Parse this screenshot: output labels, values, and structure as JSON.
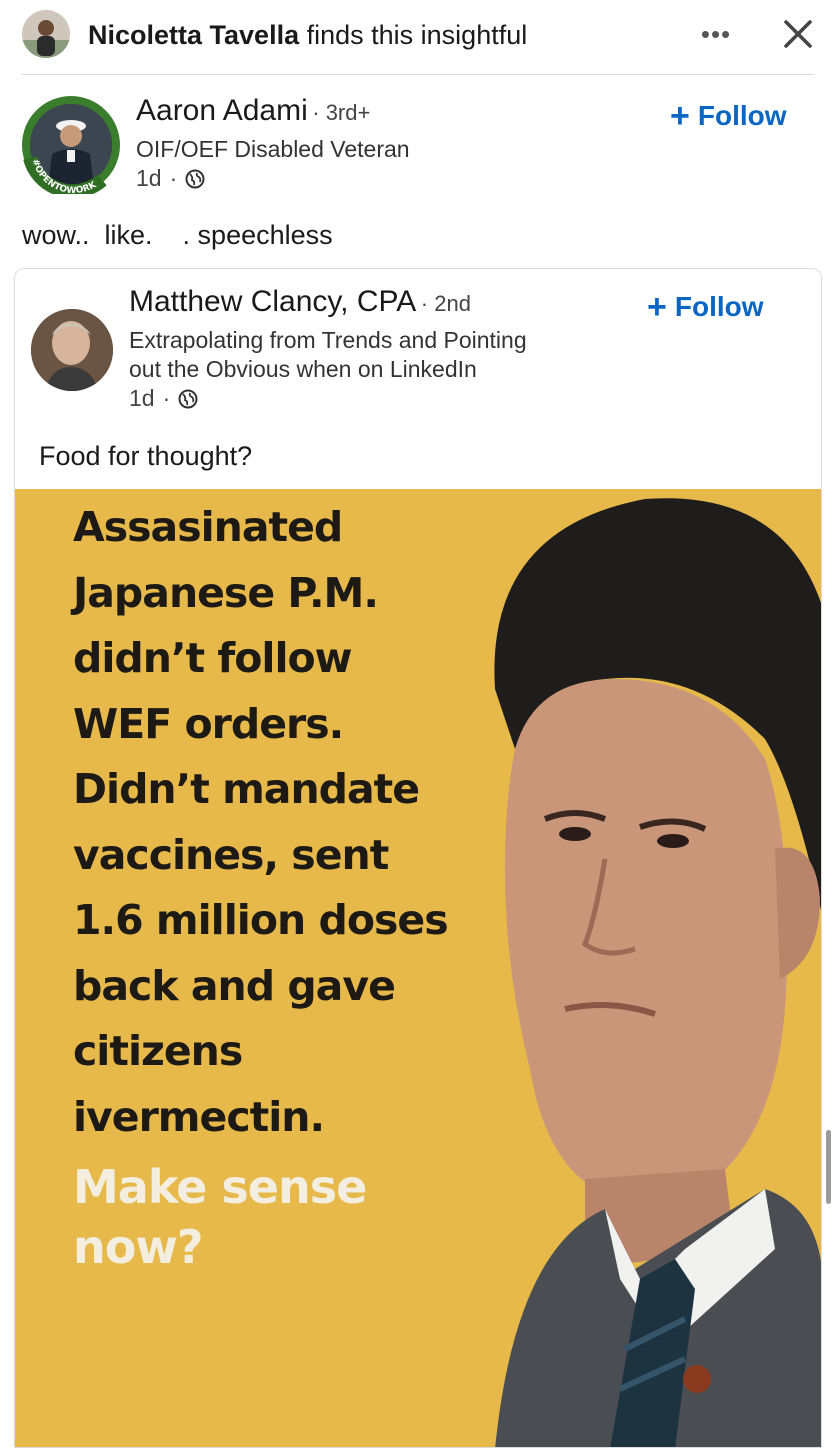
{
  "activity": {
    "actor": "Nicoletta Tavella",
    "action": "finds this insightful",
    "more_icon": "more-horizontal-icon",
    "close_icon": "close-icon"
  },
  "post": {
    "author": {
      "name": "Aaron Adami",
      "degree": "3rd+",
      "headline": "OIF/OEF Disabled Veteran",
      "time": "1d",
      "visibility_icon": "globe-icon",
      "badge": "#OPENTOWORK"
    },
    "follow_label": "Follow",
    "text": "wow..  like.    . speechless"
  },
  "shared_post": {
    "author": {
      "name": "Matthew Clancy, CPA",
      "degree": "2nd",
      "headline_line1": "Extrapolating from Trends and Pointing",
      "headline_line2": "out the Obvious when on LinkedIn",
      "time": "1d",
      "visibility_icon": "globe-icon"
    },
    "follow_label": "Follow",
    "text": "Food for thought?",
    "image": {
      "lines": [
        "Assasinated",
        "Japanese P.M.",
        "didn’t follow",
        "WEF orders.",
        "Didn’t mandate",
        "vaccines, sent",
        "1.6 million doses",
        "back and gave",
        "citizens",
        "ivermectin."
      ],
      "cta_lines": [
        "Make sense",
        "now?"
      ],
      "background_color": "#e6b94a"
    }
  },
  "colors": {
    "link_blue": "#0a66c2",
    "text_dark": "#1a1a1a"
  }
}
